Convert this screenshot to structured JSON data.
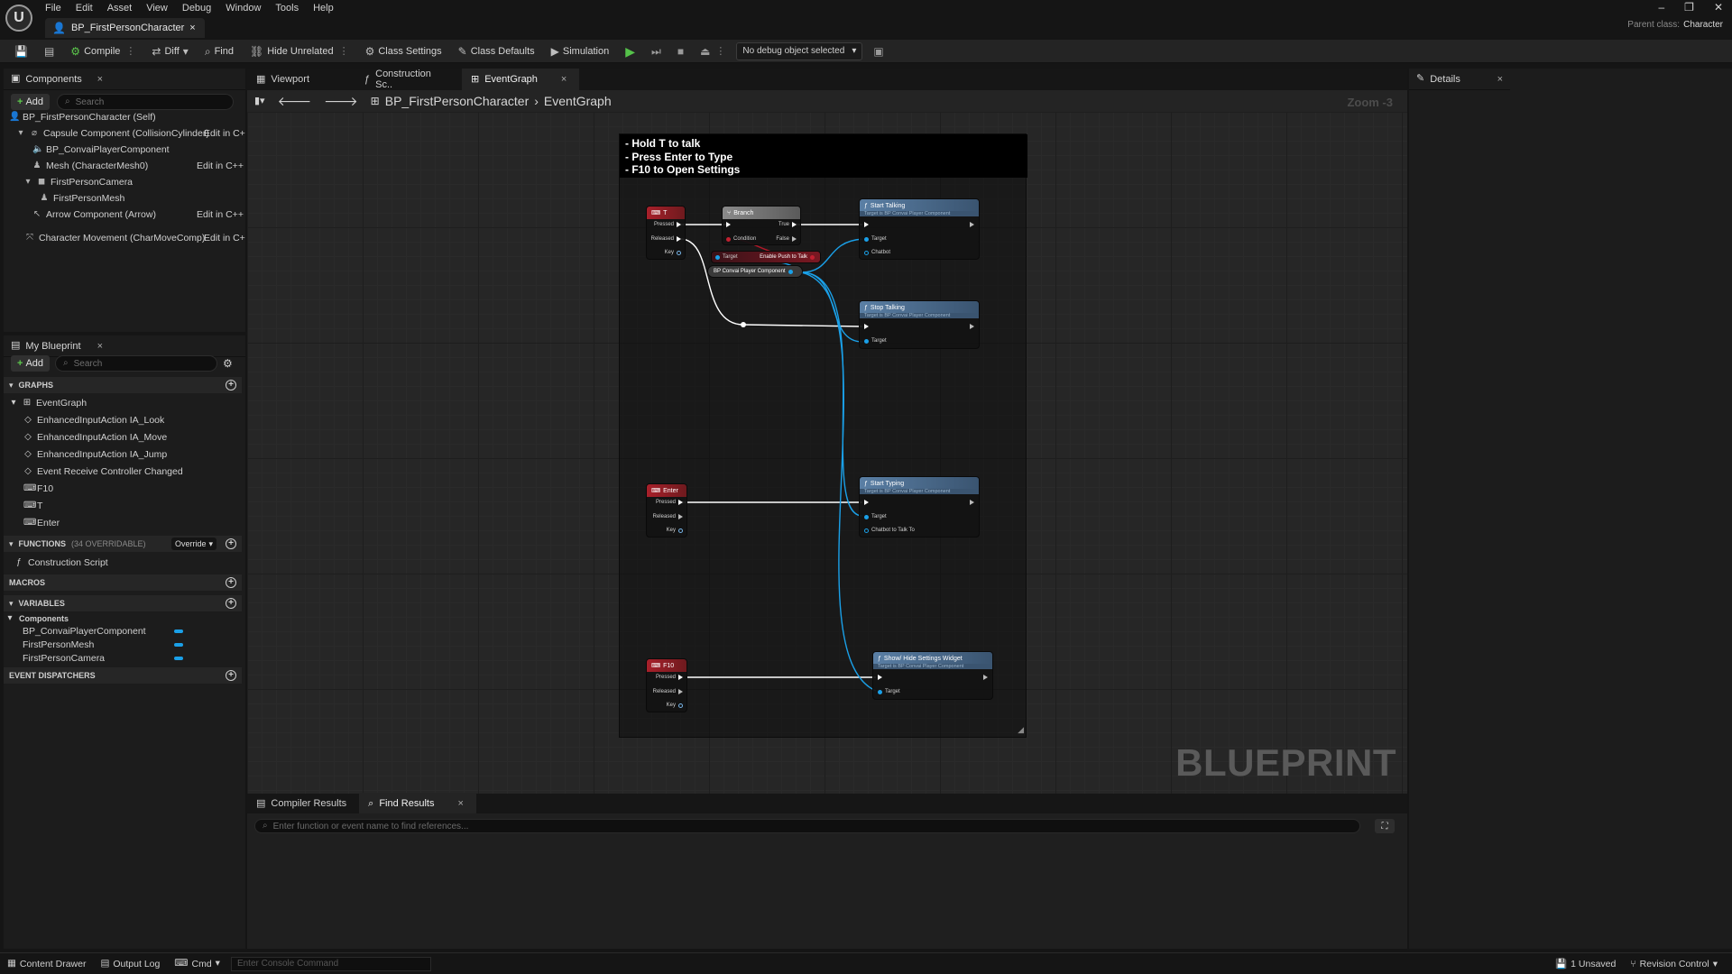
{
  "menu": [
    "File",
    "Edit",
    "Asset",
    "View",
    "Debug",
    "Window",
    "Tools",
    "Help"
  ],
  "doc_tab": "BP_FirstPersonCharacter",
  "parent_class": {
    "label": "Parent class:",
    "value": "Character"
  },
  "toolbar": {
    "compile": "Compile",
    "diff": "Diff",
    "find": "Find",
    "hide_unrelated": "Hide Unrelated",
    "class_settings": "Class Settings",
    "class_defaults": "Class Defaults",
    "simulation": "Simulation",
    "debug_object": "No debug object selected"
  },
  "components": {
    "tab": "Components",
    "add": "Add",
    "search_placeholder": "Search",
    "items": [
      {
        "label": "BP_FirstPersonCharacter (Self)",
        "edit": ""
      },
      {
        "label": "Capsule Component (CollisionCylinder)",
        "edit": "Edit in C+"
      },
      {
        "label": "BP_ConvaiPlayerComponent",
        "edit": ""
      },
      {
        "label": "Mesh (CharacterMesh0)",
        "edit": "Edit in C++"
      },
      {
        "label": "FirstPersonCamera",
        "edit": ""
      },
      {
        "label": "FirstPersonMesh",
        "edit": ""
      },
      {
        "label": "Arrow Component (Arrow)",
        "edit": "Edit in C++"
      },
      {
        "label": "Character Movement (CharMoveComp)",
        "edit": "Edit in C+"
      }
    ]
  },
  "my_blueprint": {
    "tab": "My Blueprint",
    "add": "Add",
    "search_placeholder": "Search",
    "graphs_header": "GRAPHS",
    "graphs": [
      "EventGraph",
      "EnhancedInputAction IA_Look",
      "EnhancedInputAction IA_Move",
      "EnhancedInputAction IA_Jump",
      "Event Receive Controller Changed",
      "F10",
      "T",
      "Enter"
    ],
    "functions_header": "FUNCTIONS",
    "functions_count": "(34 OVERRIDABLE)",
    "override": "Override",
    "functions": [
      "Construction Script"
    ],
    "macros_header": "MACROS",
    "variables_header": "VARIABLES",
    "variables_group": "Components",
    "variables": [
      "BP_ConvaiPlayerComponent",
      "FirstPersonMesh",
      "FirstPersonCamera"
    ],
    "dispatchers_header": "EVENT DISPATCHERS"
  },
  "graph_tabs": [
    "Viewport",
    "Construction Sc..",
    "EventGraph"
  ],
  "breadcrumb": {
    "root": "BP_FirstPersonCharacter",
    "current": "EventGraph"
  },
  "zoom": "Zoom -3",
  "watermark": "BLUEPRINT",
  "comment_lines": [
    "- Hold T to talk",
    "- Press Enter to Type",
    "- F10 to Open Settings"
  ],
  "nodes": {
    "key_t": {
      "title": "T",
      "pins": [
        "Pressed",
        "Released",
        "Key"
      ]
    },
    "branch": {
      "title": "Branch",
      "pins": [
        "Condition",
        "True",
        "False"
      ]
    },
    "get_ptt": {
      "target": "Target",
      "title": "Enable Push to Talk"
    },
    "convai_ref": {
      "title": "BP Convai Player Component"
    },
    "start_talking": {
      "title": "Start Talking",
      "sub": "Target is BP Convai Player Component",
      "pins": [
        "Target",
        "Chatbot"
      ]
    },
    "stop_talking": {
      "title": "Stop Talking",
      "sub": "Target is BP Convai Player Component",
      "pins": [
        "Target"
      ]
    },
    "key_enter": {
      "title": "Enter",
      "pins": [
        "Pressed",
        "Released",
        "Key"
      ]
    },
    "start_typing": {
      "title": "Start Typing",
      "sub": "Target is BP Convai Player Component",
      "pins": [
        "Target",
        "Chatbot to Talk To"
      ]
    },
    "key_f10": {
      "title": "F10",
      "pins": [
        "Pressed",
        "Released",
        "Key"
      ]
    },
    "settings": {
      "title": "Show/ Hide Settings Widget",
      "sub": "Target is BP Convai Player Component",
      "pins": [
        "Target"
      ]
    }
  },
  "bottom_tabs": [
    "Compiler Results",
    "Find Results"
  ],
  "find_placeholder": "Enter function or event name to find references...",
  "details_tab": "Details",
  "status": {
    "content_drawer": "Content Drawer",
    "output_log": "Output Log",
    "cmd": "Cmd",
    "console_placeholder": "Enter Console Command",
    "unsaved": "1 Unsaved",
    "revision": "Revision Control"
  },
  "colors": {
    "accent_blue": "#1aa0e8",
    "play_green": "#55c24a",
    "event_red": "#a8202a",
    "func_blue": "#5a7fa5"
  }
}
